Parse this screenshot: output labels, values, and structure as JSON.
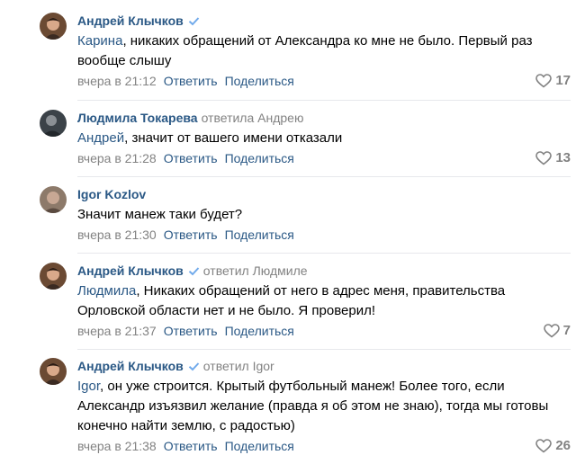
{
  "comments": [
    {
      "author": "Андрей Клычков",
      "verified": true,
      "reply_to": "",
      "addressee": "Карина",
      "text": ", никаких обращений от Александра ко мне не было. Первый раз вообще слышу",
      "time": "вчера в 21:12",
      "reply_label": "Ответить",
      "share_label": "Поделиться",
      "likes": "17"
    },
    {
      "author": "Людмила Токарева",
      "verified": false,
      "reply_to": "ответила Андрею",
      "addressee": "Андрей",
      "text": ", значит от вашего имени отказали",
      "time": "вчера в 21:28",
      "reply_label": "Ответить",
      "share_label": "Поделиться",
      "likes": "13"
    },
    {
      "author": "Igor Kozlov",
      "verified": false,
      "reply_to": "",
      "addressee": "",
      "text": "Значит манеж таки будет?",
      "time": "вчера в 21:30",
      "reply_label": "Ответить",
      "share_label": "Поделиться",
      "likes": ""
    },
    {
      "author": "Андрей Клычков",
      "verified": true,
      "reply_to": "ответил Людмиле",
      "addressee": "Людмила",
      "text": ", Никаких обращений от него в адрес меня, правительства Орловской области нет и не было. Я проверил!",
      "time": "вчера в 21:37",
      "reply_label": "Ответить",
      "share_label": "Поделиться",
      "likes": "7"
    },
    {
      "author": "Андрей Клычков",
      "verified": true,
      "reply_to": "ответил Igor",
      "addressee": "Igor",
      "text": ", он уже строится. Крытый футбольный манеж! Более того, если Александр изъязвил желание (правда я об этом не знаю), тогда мы готовы конечно найти землю, с радостью)",
      "time": "вчера в 21:38",
      "reply_label": "Ответить",
      "share_label": "Поделиться",
      "likes": "26"
    }
  ],
  "colors": {
    "link": "#2a5885",
    "muted": "#828282",
    "divider": "#e7e8ec",
    "verified": "#71aaeb"
  },
  "icons": {
    "verified": "checkmark-icon",
    "like": "heart-outline-icon"
  }
}
